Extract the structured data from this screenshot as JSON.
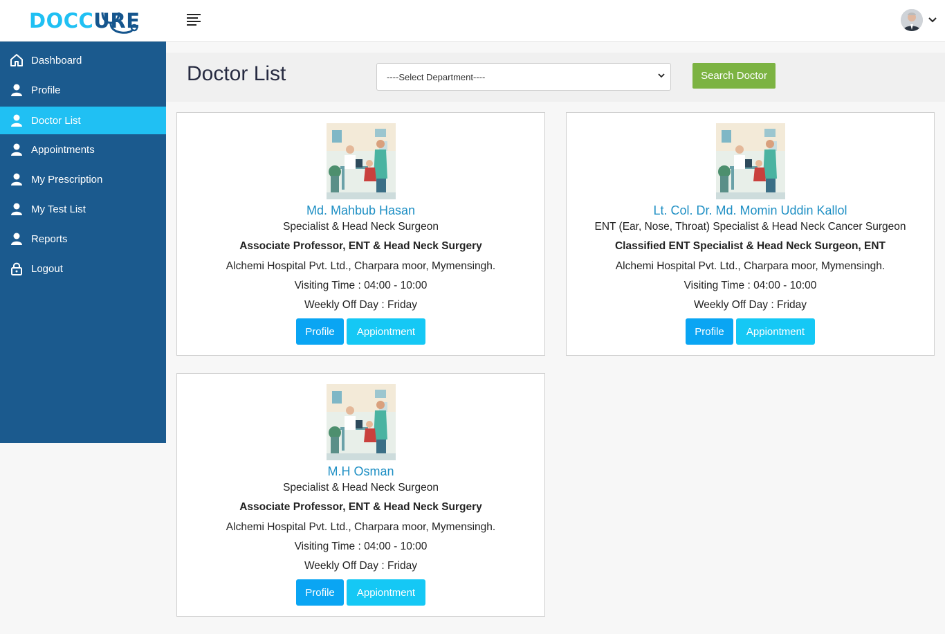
{
  "brand": {
    "part1": "DOCC",
    "part2": "U",
    "part3": "RE"
  },
  "sidebar": {
    "items": [
      {
        "label": "Dashboard",
        "icon": "home-icon",
        "active": false
      },
      {
        "label": "Profile",
        "icon": "user-icon",
        "active": false
      },
      {
        "label": "Doctor List",
        "icon": "user-icon",
        "active": true
      },
      {
        "label": "Appointments",
        "icon": "user-icon",
        "active": false
      },
      {
        "label": "My Prescription",
        "icon": "user-icon",
        "active": false
      },
      {
        "label": "My Test List",
        "icon": "user-icon",
        "active": false
      },
      {
        "label": "Reports",
        "icon": "user-icon",
        "active": false
      },
      {
        "label": "Logout",
        "icon": "lock-icon",
        "active": false
      }
    ]
  },
  "header": {
    "page_title": "Doctor List",
    "department_select": {
      "selected": "----Select Department----"
    },
    "search_button": "Search Doctor"
  },
  "doctors": [
    {
      "name": "Md. Mahbub Hasan",
      "specialty": "Specialist & Head Neck Surgeon",
      "designation": "Associate Professor, ENT & Head Neck Surgery",
      "hospital": "Alchemi Hospital Pvt. Ltd., Charpara moor, Mymensingh.",
      "visiting_time": "Visiting Time : 04:00 - 10:00",
      "off_day": "Weekly Off Day : Friday",
      "profile_button": "Profile",
      "appointment_button": "Appiontment"
    },
    {
      "name": "Lt. Col. Dr. Md. Momin Uddin Kallol",
      "specialty": "ENT (Ear, Nose, Throat) Specialist & Head Neck Cancer Surgeon",
      "designation": "Classified ENT Specialist & Head Neck Surgeon, ENT",
      "hospital": "Alchemi Hospital Pvt. Ltd., Charpara moor, Mymensingh.",
      "visiting_time": "Visiting Time : 04:00 - 10:00",
      "off_day": "Weekly Off Day : Friday",
      "profile_button": "Profile",
      "appointment_button": "Appiontment"
    },
    {
      "name": "M.H Osman",
      "specialty": "Specialist & Head Neck Surgeon",
      "designation": "Associate Professor, ENT & Head Neck Surgery",
      "hospital": "Alchemi Hospital Pvt. Ltd., Charpara moor, Mymensingh.",
      "visiting_time": "Visiting Time : 04:00 - 10:00",
      "off_day": "Weekly Off Day : Friday",
      "profile_button": "Profile",
      "appointment_button": "Appiontment"
    }
  ],
  "colors": {
    "sidebar_bg": "#1b5a8e",
    "accent": "#20c0f3",
    "search_button": "#7cb342",
    "doctor_name": "#1e8fc4",
    "profile_button": "#0aa5f3",
    "appointment_button": "#15c8f5"
  }
}
